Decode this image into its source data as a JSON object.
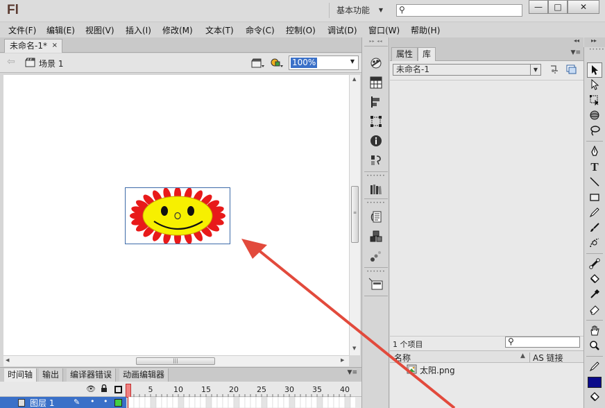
{
  "app": {
    "logo": "Fl",
    "workspace": "基本功能",
    "window_controls": {
      "minimize": "—",
      "maximize": "□",
      "close": "✕"
    }
  },
  "menu": [
    "文件(F)",
    "编辑(E)",
    "视图(V)",
    "插入(I)",
    "修改(M)",
    "文本(T)",
    "命令(C)",
    "控制(O)",
    "调试(D)",
    "窗口(W)",
    "帮助(H)"
  ],
  "document": {
    "tab_title": "未命名-1*",
    "tab_close": "×",
    "scene_label": "场景 1",
    "zoom": "100%"
  },
  "timeline": {
    "tabs": [
      "时间轴",
      "输出",
      "编译器错误",
      "动画编辑器"
    ],
    "frame_numbers": [
      "1",
      "5",
      "10",
      "15",
      "20",
      "25",
      "30",
      "35",
      "40"
    ],
    "layer_name": "图层 1",
    "current_frame": 1
  },
  "library": {
    "tabs": [
      "属性",
      "库"
    ],
    "active_tab": "库",
    "document_select": "未命名-1",
    "item_count": "1 个项目",
    "col_name": "名称",
    "col_sort": "▲",
    "col_linkage": "AS 链接",
    "items": [
      {
        "name": "太阳.png",
        "icon": "bitmap-icon"
      }
    ]
  },
  "dock_icons": [
    "color-icon",
    "swatches-icon",
    "align-icon",
    "transform-icon",
    "info-icon",
    "code-snippets-icon",
    "library-books-icon",
    "actions-icon",
    "components-icon",
    "motion-presets-icon",
    "project-icon"
  ],
  "tools": [
    "selection-tool",
    "subselection-tool",
    "free-transform-tool",
    "3d-rotation-tool",
    "lasso-tool",
    "pen-tool",
    "text-tool",
    "line-tool",
    "rectangle-tool",
    "pencil-tool",
    "brush-tool",
    "deco-tool",
    "bone-tool",
    "paint-bucket-tool",
    "eyedropper-tool",
    "eraser-tool",
    "hand-tool",
    "zoom-tool",
    "stroke-color-tool",
    "fill-color-tool"
  ],
  "colors": {
    "accent": "#3a70c8",
    "annotation_arrow": "#e24a3c",
    "fill_color": "#0a0a8a",
    "sun_petals": "#e81a1a",
    "sun_face": "#f7f000"
  }
}
